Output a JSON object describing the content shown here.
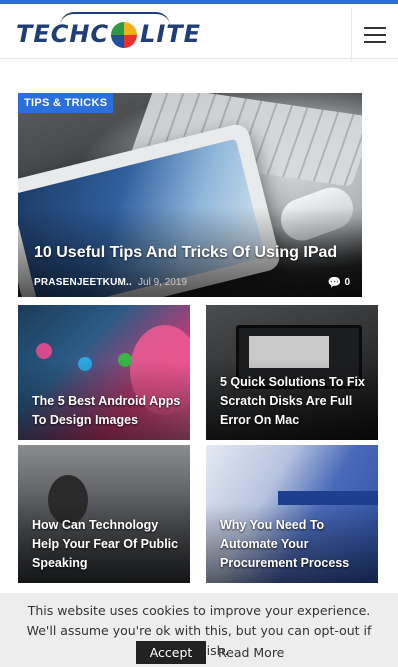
{
  "header": {
    "logo_left": "TECHC",
    "logo_right": "LITE",
    "menu_icon": "hamburger-menu-icon"
  },
  "hero": {
    "tag": "TIPS & TRICKS",
    "title": "10 Useful Tips And Tricks Of Using IPad",
    "author": "PRASENJEETKUM..",
    "date": "Jul 9, 2019",
    "comments": "0",
    "comment_icon": "comment-icon"
  },
  "articles": [
    {
      "title": "The 5 Best Android Apps To Design Images"
    },
    {
      "title": "5 Quick Solutions To Fix Scratch Disks Are Full Error On Mac"
    },
    {
      "title": "How Can Technology Help Your Fear Of Public Speaking"
    },
    {
      "title": "Why You Need To Automate Your Procurement Process"
    }
  ],
  "cookie": {
    "text": "This website uses cookies to improve your experience. We'll assume you're ok with this, but you can opt-out if you wish.",
    "accept_label": "Accept",
    "read_more_label": "Read More"
  },
  "colors": {
    "accent": "#2a6fdc",
    "logo": "#1f3e78",
    "cookie_bar": "#ededed"
  }
}
